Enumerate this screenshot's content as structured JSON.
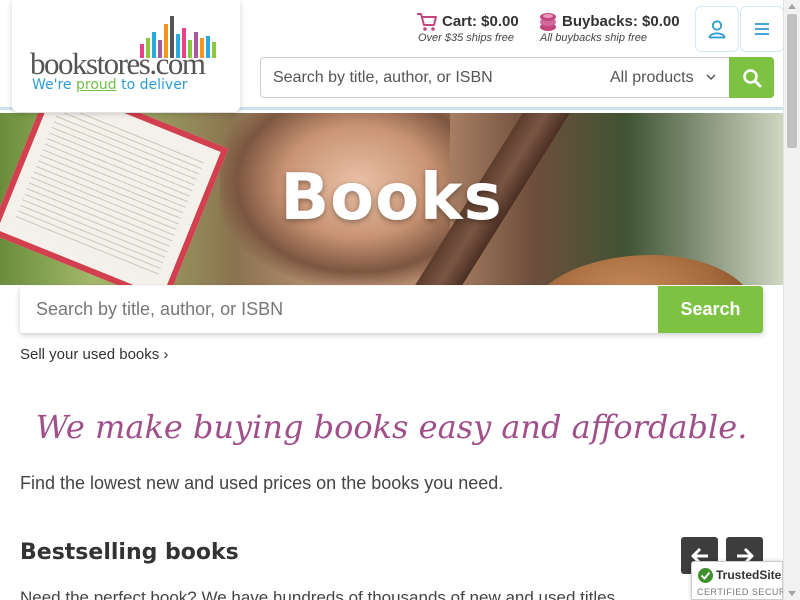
{
  "header": {
    "logo": {
      "wordmark_main": "bookstores",
      "wordmark_tld": ".com",
      "tagline_before": "We're ",
      "tagline_emphasis": "proud",
      "tagline_after": " to deliver"
    },
    "cart": {
      "label": "Cart: $0.00",
      "subtext": "Over $35 ships free",
      "icon": "cart-icon"
    },
    "buybacks": {
      "label": "Buybacks: $0.00",
      "subtext": "All buybacks ship free",
      "icon": "coins-icon"
    },
    "account_icon": "user-icon",
    "menu_icon": "menu-icon",
    "search": {
      "placeholder": "Search by title, author, or ISBN",
      "category_selected": "All products",
      "button_icon": "search-icon"
    }
  },
  "hero": {
    "title": "Books"
  },
  "main_search": {
    "placeholder": "Search by title, author, or ISBN",
    "button_label": "Search"
  },
  "sell_link": "Sell your used books ›",
  "tagline": "We make buying books easy and affordable.",
  "lead": "Find the lowest new and used prices on the books you need.",
  "bestselling": {
    "title": "Bestselling books",
    "description": "Need the perfect book? We have hundreds of thousands of new and used titles",
    "prev_icon": "arrow-left-icon",
    "next_icon": "arrow-right-icon"
  },
  "trusted_badge": {
    "title": "TrustedSite",
    "subtitle": "CERTIFIED SECURE"
  },
  "colors": {
    "accent_green": "#7dc242",
    "tagline_purple": "#a04f8a",
    "brand_blue": "#2c9bd1",
    "cart_pink": "#c2477f"
  }
}
